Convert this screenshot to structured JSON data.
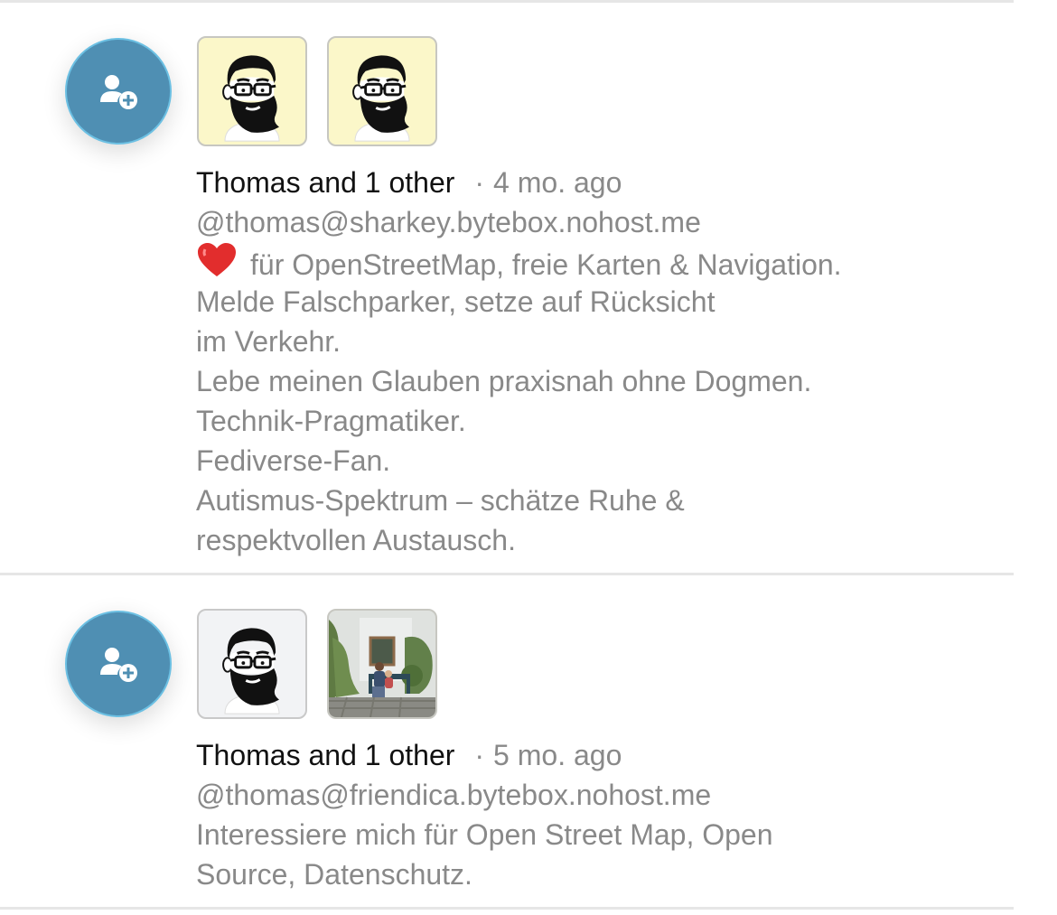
{
  "colors": {
    "badge": "#4f8fb3",
    "badge_border": "#6cc0e3",
    "meta_text": "#898989",
    "name_text": "#111111"
  },
  "notifications": [
    {
      "type": "follow",
      "badge_icon": "add-user-icon",
      "thumbnails": [
        "bearded-avatar-yellow",
        "bearded-avatar-yellow"
      ],
      "actor_name": "Thomas",
      "actor_suffix": "and 1 other",
      "separator": "·",
      "time": "4 mo. ago",
      "handle": "@thomas@sharkey.bytebox.nohost.me",
      "bio_first_line": "für OpenStreetMap, freie Karten & Navigation.",
      "bio_lines": [
        "Melde Falschparker, setze auf Rücksicht",
        "im Verkehr.",
        "Lebe meinen Glauben praxisnah ohne Dogmen.",
        "Technik-Pragmatiker.",
        "Fediverse-Fan.",
        "Autismus-Spektrum – schätze Ruhe &",
        "respektvollen Austausch."
      ]
    },
    {
      "type": "follow",
      "badge_icon": "add-user-icon",
      "thumbnails": [
        "bearded-avatar-gray",
        "garden-bench-photo"
      ],
      "actor_name": "Thomas",
      "actor_suffix": "and 1 other",
      "separator": "·",
      "time": "5 mo. ago",
      "handle": "@thomas@friendica.bytebox.nohost.me",
      "bio_lines": [
        "Interessiere mich für Open Street Map, Open",
        "Source, Datenschutz."
      ]
    }
  ]
}
